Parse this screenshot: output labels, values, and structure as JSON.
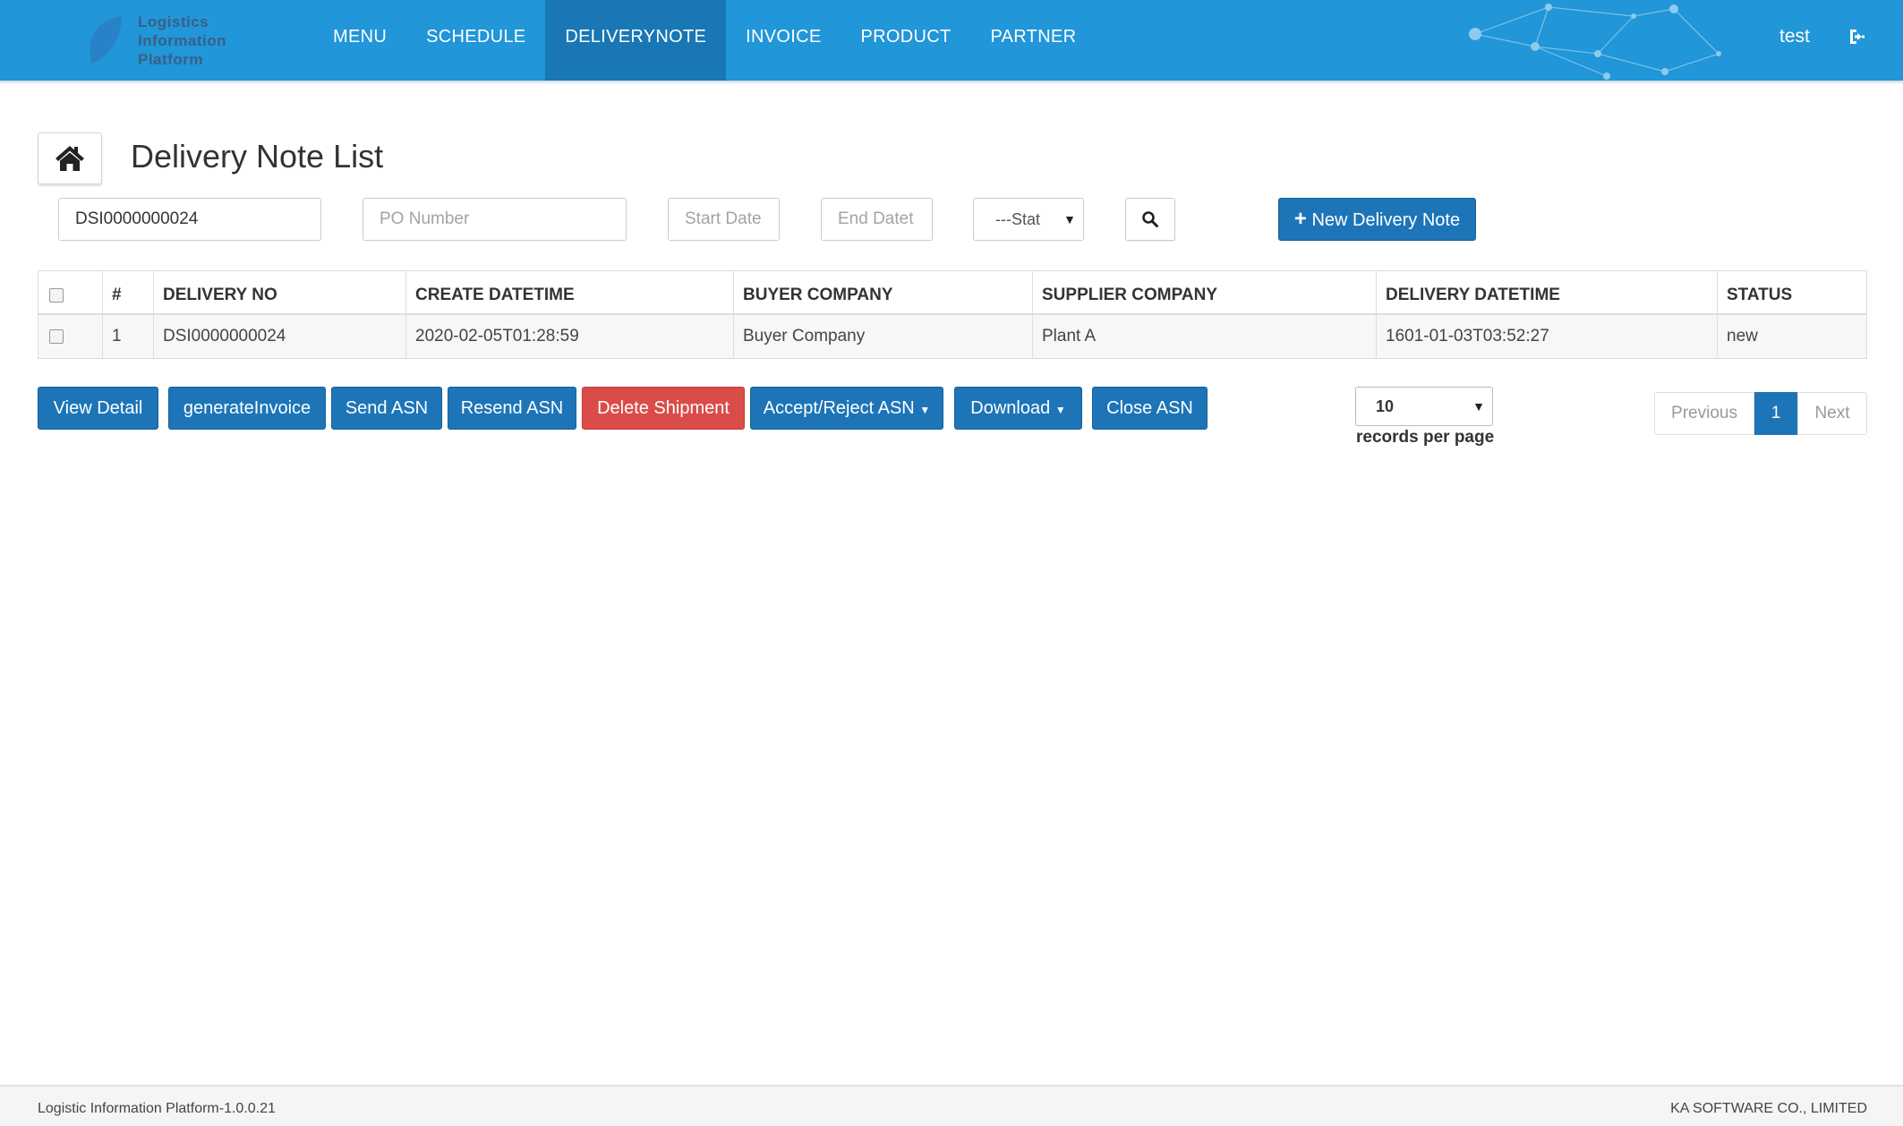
{
  "brand": {
    "line1": "Logistics",
    "line2": "Information",
    "line3": "Platform"
  },
  "nav": {
    "items": [
      {
        "label": "MENU"
      },
      {
        "label": "SCHEDULE"
      },
      {
        "label": "DELIVERYNOTE",
        "active": true
      },
      {
        "label": "INVOICE"
      },
      {
        "label": "PRODUCT"
      },
      {
        "label": "PARTNER"
      }
    ],
    "user": "test"
  },
  "page": {
    "title": "Delivery Note List"
  },
  "filters": {
    "delivery_no_value": "DSI0000000024",
    "po_placeholder": "PO Number",
    "start_placeholder": "Start Date",
    "end_placeholder": "End Datet",
    "status_label": "---Stat",
    "new_button": "New Delivery Note"
  },
  "table": {
    "headers": [
      "#",
      "DELIVERY NO",
      "CREATE DATETIME",
      "BUYER COMPANY",
      "SUPPLIER COMPANY",
      "DELIVERY DATETIME",
      "STATUS"
    ],
    "rows": [
      [
        "1",
        "DSI0000000024",
        "2020-02-05T01:28:59",
        "Buyer Company",
        "Plant A",
        "1601-01-03T03:52:27",
        "new"
      ]
    ]
  },
  "actions": {
    "view_detail": "View Detail",
    "generate_invoice": "generateInvoice",
    "send_asn": "Send ASN",
    "resend_asn": "Resend ASN",
    "delete_shipment": "Delete Shipment",
    "accept_reject": "Accept/Reject ASN",
    "download": "Download",
    "close_asn": "Close ASN"
  },
  "paging": {
    "per_page": "10",
    "per_page_label": "records per page",
    "previous": "Previous",
    "current": "1",
    "next": "Next"
  },
  "footer": {
    "left": "Logistic Information Platform-1.0.0.21",
    "right": "KA SOFTWARE CO., LIMITED"
  },
  "colors": {
    "nav": "#2196d8",
    "nav_active": "#1877b4",
    "primary": "#1d75b8",
    "danger": "#da4c48"
  }
}
